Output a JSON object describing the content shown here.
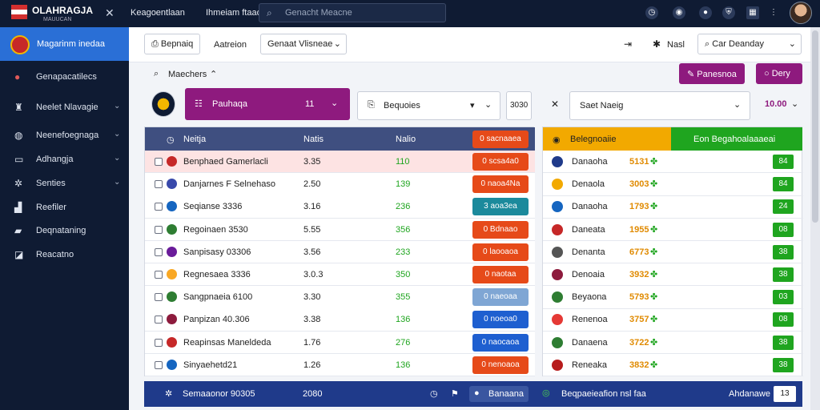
{
  "header": {
    "logo_title": "OLAHRAGJA",
    "logo_subtitle": "MAUUCAN",
    "nav": [
      "Keagoentlaan",
      "Ihmeiam ftaao"
    ],
    "search_placeholder": "Genacht Meacne"
  },
  "sidebar": {
    "active": "Magarinm inedaa",
    "items": [
      {
        "label": "Genapacatilecs",
        "icon": "record-icon",
        "chevron": false
      },
      {
        "label": "Neelet Nlavagie",
        "icon": "trophy-icon",
        "chevron": true
      },
      {
        "label": "Neenefoegnaga",
        "icon": "globe-icon",
        "chevron": true
      },
      {
        "label": "Adhangja",
        "icon": "box-icon",
        "chevron": true
      },
      {
        "label": "Senties",
        "icon": "gear-icon",
        "chevron": true
      },
      {
        "label": "Reefiler",
        "icon": "stadium-icon",
        "chevron": false
      },
      {
        "label": "Deqnataning",
        "icon": "car-icon",
        "chevron": false
      },
      {
        "label": "Reacatno",
        "icon": "square-icon",
        "chevron": false
      }
    ]
  },
  "toolbar": {
    "btn1": "Bepnaiq",
    "btn2": "Aatreion",
    "select1": "Genaat Vlisneae",
    "btn3": "Nasl",
    "select2": "Car Deanday"
  },
  "controls": {
    "matches_label": "Maechers",
    "purple1": "Panesnoa",
    "purple2": "Dery",
    "league_select": "Pauhaqa",
    "league_count": "11",
    "group_select": "Bequoies",
    "small_box": "3030",
    "field_select": "Saet Naeig",
    "odds_value": "10.00"
  },
  "left_table": {
    "headers": [
      "Neitja",
      "Natis",
      "Nalio",
      "0 sacnaaea"
    ],
    "rows": [
      {
        "name": "Benphaed Gamerlacli",
        "odds": "3.35",
        "value": "110",
        "status": "0 scsa4a0",
        "pill_color": "#e64a19",
        "badge_color": "#c62828"
      },
      {
        "name": "Danjarnes F Selnehaso",
        "odds": "2.50",
        "value": "139",
        "status": "0 naoa4Na",
        "pill_color": "#e64a19",
        "badge_color": "#3949ab"
      },
      {
        "name": "Seqianse 3336",
        "odds": "3.16",
        "value": "236",
        "status": "3 aoa3ea",
        "pill_color": "#1b8a9c",
        "badge_color": "#1565c0"
      },
      {
        "name": "Regoinaen 3530",
        "odds": "5.55",
        "value": "356",
        "status": "0 Bdnaao",
        "pill_color": "#e64a19",
        "badge_color": "#2e7d32"
      },
      {
        "name": "Sanpisasy 03306",
        "odds": "3.56",
        "value": "233",
        "status": "0 laooaoa",
        "pill_color": "#e64a19",
        "badge_color": "#6a1b9a"
      },
      {
        "name": "Regnesaea 3336",
        "odds": "3.0.3",
        "value": "350",
        "status": "0 naotaa",
        "pill_color": "#e64a19",
        "badge_color": "#f9a825"
      },
      {
        "name": "Sangpnaeia 6100",
        "odds": "3.30",
        "value": "355",
        "status": "0 naeoaa",
        "pill_color": "#7fa6d4",
        "badge_color": "#2e7d32"
      },
      {
        "name": "Panpizan 40.306",
        "odds": "3.38",
        "value": "136",
        "status": "0 noeoa0",
        "pill_color": "#1e5fd0",
        "badge_color": "#8d1b3d"
      },
      {
        "name": "Reapinsas Maneldeda",
        "odds": "1.76",
        "value": "276",
        "status": "0 naocaoa",
        "pill_color": "#1e5fd0",
        "badge_color": "#c62828"
      },
      {
        "name": "Sinyaehetd21",
        "odds": "1.26",
        "value": "136",
        "status": "0 nenoaoa",
        "pill_color": "#e64a19",
        "badge_color": "#1565c0"
      }
    ]
  },
  "right_table": {
    "header_left": "Belegnoaiie",
    "header_right": "Eon Begahoalaaaeai",
    "rows": [
      {
        "team": "Danaoha",
        "score": "5131",
        "value": "84",
        "color": "#1f3a8a"
      },
      {
        "team": "Denaola",
        "score": "3003",
        "value": "84",
        "color": "#f2a900"
      },
      {
        "team": "Danaoha",
        "score": "1793",
        "value": "24",
        "color": "#1565c0"
      },
      {
        "team": "Daneata",
        "score": "1955",
        "value": "08",
        "color": "#c62828"
      },
      {
        "team": "Denanta",
        "score": "6773",
        "value": "38",
        "color": "#555555"
      },
      {
        "team": "Denoaia",
        "score": "3932",
        "value": "38",
        "color": "#8d1b3d"
      },
      {
        "team": "Beyaona",
        "score": "5793",
        "value": "03",
        "color": "#2e7d32"
      },
      {
        "team": "Renenoa",
        "score": "3757",
        "value": "08",
        "color": "#e53935"
      },
      {
        "team": "Danaena",
        "score": "3722",
        "value": "38",
        "color": "#2e7d32"
      },
      {
        "team": "Reneaka",
        "score": "3832",
        "value": "38",
        "color": "#b71c1c"
      }
    ]
  },
  "footer": {
    "left": "Semaaonor 90305",
    "mid": "2080",
    "btn": "Banaana",
    "info": "Beqpaeieafion nsl faa",
    "right": "Ahdanawe",
    "small": "13"
  },
  "colors": {
    "purple": "#8e1a7e",
    "green": "#1fa51f",
    "orange": "#f2a900",
    "navy": "#0f1b33"
  }
}
